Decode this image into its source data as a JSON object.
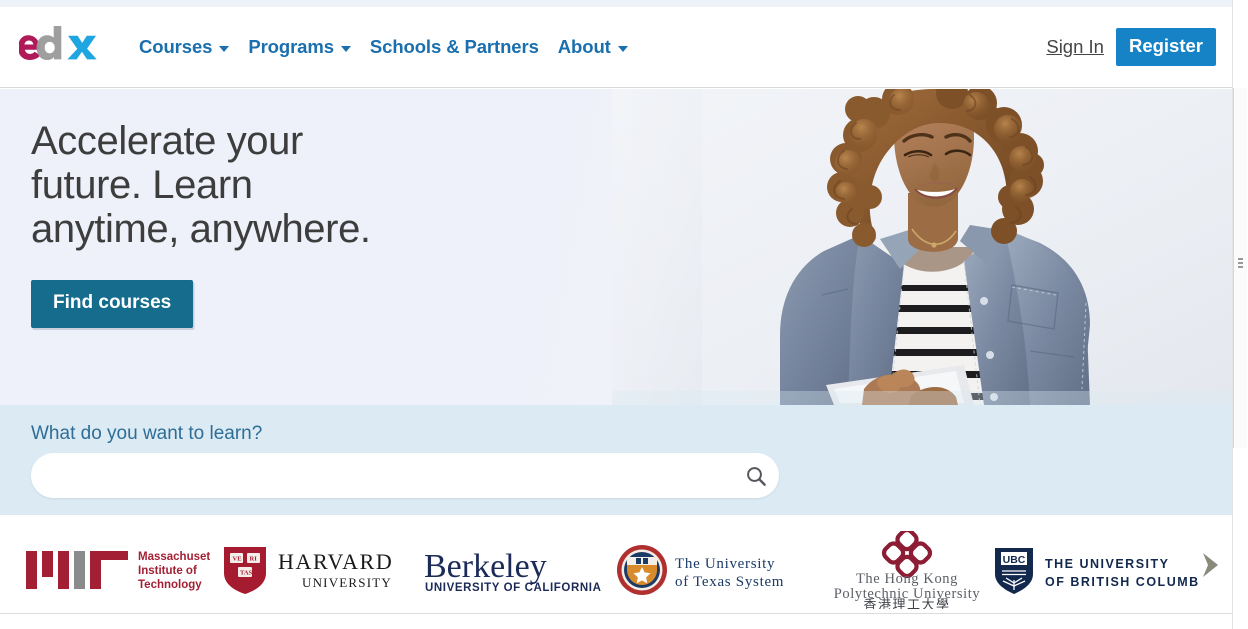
{
  "site": {
    "logo_text": "edX",
    "logo_colors": {
      "e": "#b01a59",
      "d": "#9a9a9a",
      "x": "#1fa6e0"
    }
  },
  "header": {
    "nav": [
      {
        "label": "Courses",
        "has_dropdown": true
      },
      {
        "label": "Programs",
        "has_dropdown": true
      },
      {
        "label": "Schools & Partners",
        "has_dropdown": false
      },
      {
        "label": "About",
        "has_dropdown": true
      }
    ],
    "sign_in_label": "Sign In",
    "register_label": "Register",
    "link_color": "#1a6fae",
    "register_bg": "#1683c6"
  },
  "hero": {
    "title": "Accelerate your\nfuture. Learn\nanytime, anywhere.",
    "cta_label": "Find courses",
    "cta_bg": "#156c8d",
    "image_alt": "Smiling woman with curly hair in denim jacket using a tablet"
  },
  "search": {
    "label": "What do you want to learn?",
    "value": "",
    "placeholder": "",
    "icon": "search-icon",
    "band_bg": "#dbeaf3"
  },
  "partners": {
    "next_icon": "chevron-right-icon",
    "items": [
      {
        "name": "mit",
        "title": "Massachusetts Institute of Technology",
        "lines": [
          "Massachusetts",
          "Institute of",
          "Technology"
        ],
        "color": "#a31f34"
      },
      {
        "name": "harvard",
        "title": "Harvard University",
        "lines": [
          "HARVARD",
          "UNIVERSITY"
        ],
        "shield_text": [
          "VE",
          "RI",
          "TAS"
        ],
        "color": "#a51c30"
      },
      {
        "name": "berkeley",
        "title": "Berkeley University of California",
        "lines": [
          "Berkeley",
          "UNIVERSITY OF CALIFORNIA"
        ],
        "color": "#1b2a57"
      },
      {
        "name": "utexas",
        "title": "The University of Texas System",
        "lines": [
          "The University",
          "of Texas System"
        ],
        "color": "#1b3a66"
      },
      {
        "name": "hkpolyu",
        "title": "The Hong Kong Polytechnic University",
        "lines": [
          "The Hong Kong",
          "Polytechnic University",
          "香港理工大學"
        ],
        "color": "#8c1d35"
      },
      {
        "name": "ubc",
        "title": "The University of British Columbia",
        "lines": [
          "THE UNIVERSITY",
          "OF BRITISH COLUMBIA"
        ],
        "badge": "UBC",
        "color": "#12284c"
      }
    ]
  }
}
